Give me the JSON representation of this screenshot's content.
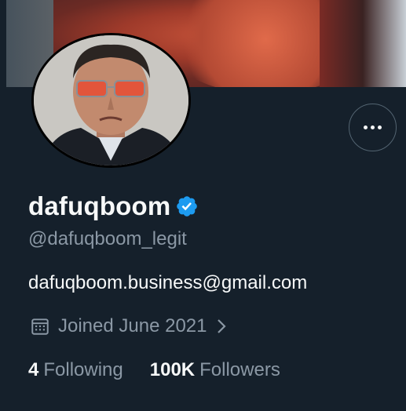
{
  "profile": {
    "display_name": "dafuqboom",
    "handle": "@dafuqboom_legit",
    "bio": "dafuqboom.business@gmail.com",
    "joined": "Joined June 2021",
    "verified": true
  },
  "stats": {
    "following_count": "4",
    "following_label": "Following",
    "followers_count": "100K",
    "followers_label": "Followers"
  },
  "icons": {
    "more": "more-icon",
    "verified": "verified-badge-icon",
    "calendar": "calendar-icon",
    "chevron": "chevron-right-icon"
  },
  "colors": {
    "background": "#15202b",
    "secondary_text": "#8b98a5",
    "verified_blue": "#1d9bf0"
  }
}
